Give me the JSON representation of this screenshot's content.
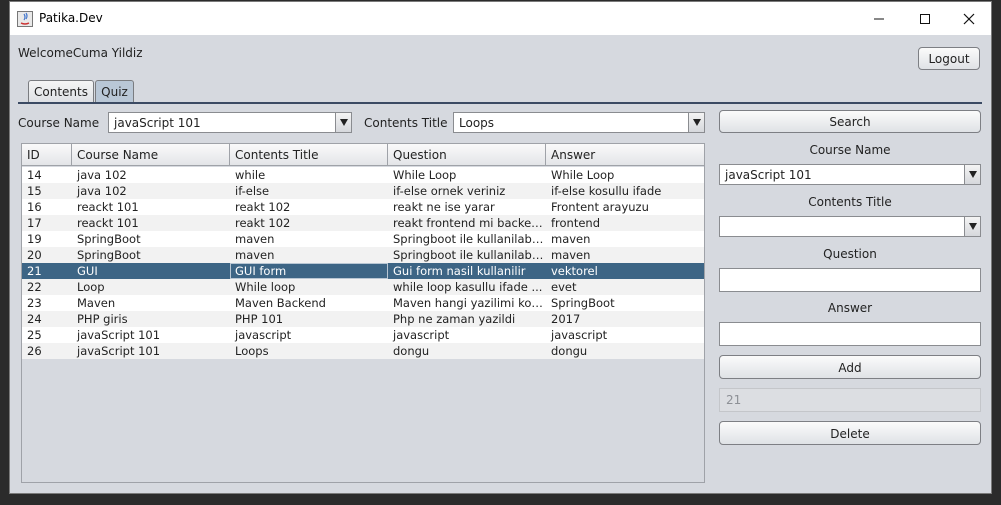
{
  "window": {
    "title": "Patika.Dev",
    "controls": [
      "minimize-icon",
      "maximize-icon",
      "close-icon"
    ]
  },
  "header": {
    "welcome": "WelcomeCuma Yildiz",
    "logout_label": "Logout"
  },
  "tabs": [
    {
      "label": "Contents",
      "active": false
    },
    {
      "label": "Quiz",
      "active": true
    }
  ],
  "filters": {
    "course_label": "Course Name",
    "course_value": "javaScript 101",
    "contents_label": "Contents Title",
    "contents_value": "Loops"
  },
  "table": {
    "columns": [
      "ID",
      "Course Name",
      "Contents Title",
      "Question",
      "Answer"
    ],
    "rows": [
      [
        "14",
        "java 102",
        "while",
        "While Loop",
        "While Loop"
      ],
      [
        "15",
        "java 102",
        "if-else",
        "if-else ornek veriniz",
        "if-else kosullu ifade"
      ],
      [
        "16",
        "reackt 101",
        "reakt 102",
        "reakt ne ise yarar",
        "Frontent arayuzu"
      ],
      [
        "17",
        "reackt 101",
        "reakt 102",
        "reakt frontend mi backen...",
        "frontend"
      ],
      [
        "19",
        "SpringBoot",
        "maven",
        "Springboot ile kullanilabil...",
        "maven"
      ],
      [
        "20",
        "SpringBoot",
        "maven",
        "Springboot ile kullanilabil...",
        "maven"
      ],
      [
        "21",
        "GUI",
        "GUI form",
        "Gui form nasil kullanilir",
        "vektorel"
      ],
      [
        "22",
        "Loop",
        "While loop",
        "while loop kasullu ifade ...",
        "evet"
      ],
      [
        "23",
        "Maven",
        "Maven Backend",
        "Maven hangi yazilimi kola...",
        "SpringBoot"
      ],
      [
        "24",
        "PHP giris",
        "PHP 101",
        "Php ne zaman yazildi",
        "2017"
      ],
      [
        "25",
        "javaScript 101",
        "javascript",
        "javascript",
        "javascript"
      ],
      [
        "26",
        "javaScript 101",
        "Loops",
        "dongu",
        "dongu"
      ]
    ],
    "selected_row": 6
  },
  "side_panel": {
    "search_label": "Search",
    "course_name_label": "Course Name",
    "course_name_value": "javaScript 101",
    "contents_title_label": "Contents Title",
    "contents_title_value": "",
    "question_label": "Question",
    "question_value": "",
    "answer_label": "Answer",
    "answer_value": "",
    "add_label": "Add",
    "selected_id_value": "21",
    "delete_label": "Delete"
  }
}
